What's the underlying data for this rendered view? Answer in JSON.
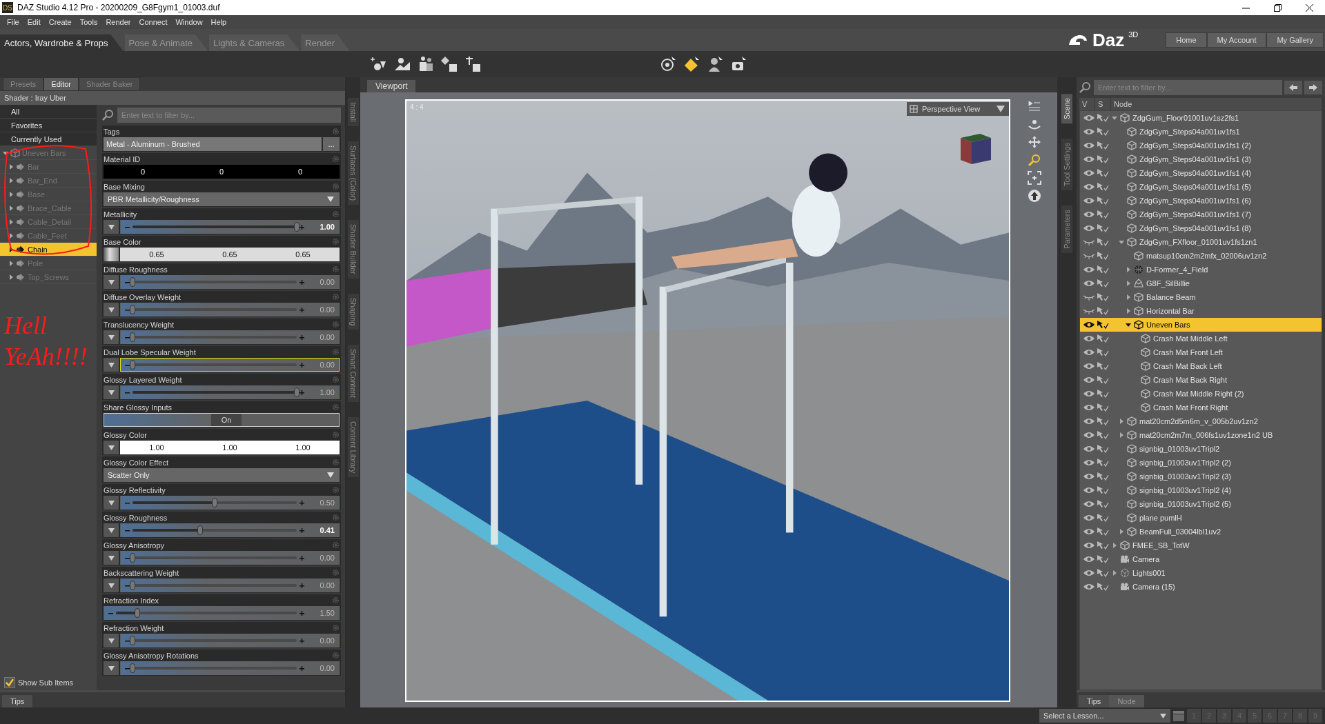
{
  "window": {
    "badge": "DS",
    "title": "DAZ Studio 4.12 Pro - 20200209_G8Fgym1_01003.duf"
  },
  "menu": [
    "File",
    "Edit",
    "Create",
    "Tools",
    "Render",
    "Connect",
    "Window",
    "Help"
  ],
  "rooms": [
    {
      "label": "Actors, Wardrobe & Props",
      "selected": true
    },
    {
      "label": "Pose & Animate",
      "selected": false
    },
    {
      "label": "Lights & Cameras",
      "selected": false
    },
    {
      "label": "Render",
      "selected": false
    }
  ],
  "brand": {
    "name": "Daz",
    "sup": "3D"
  },
  "links": [
    "Home",
    "My Account",
    "My Gallery"
  ],
  "left_panel": {
    "tabs": [
      {
        "label": "Presets",
        "selected": false
      },
      {
        "label": "Editor",
        "selected": true
      },
      {
        "label": "Shader Baker",
        "selected": false
      }
    ],
    "shader": "Shader : Iray Uber",
    "filters": [
      "All",
      "Favorites",
      "Currently Used"
    ],
    "tree": {
      "label": "Uneven Bars",
      "expanded": true,
      "children": [
        {
          "label": "Bar",
          "expanded": false,
          "selected": false
        },
        {
          "label": "Bar_End",
          "expanded": false,
          "selected": false
        },
        {
          "label": "Base",
          "expanded": false,
          "selected": false
        },
        {
          "label": "Brace_Cable",
          "expanded": false,
          "selected": false
        },
        {
          "label": "Cable_Detail",
          "expanded": false,
          "selected": false
        },
        {
          "label": "Cable_Feet",
          "expanded": false,
          "selected": false
        },
        {
          "label": "Chain",
          "expanded": false,
          "selected": true
        },
        {
          "label": "Pole",
          "expanded": false,
          "selected": false
        },
        {
          "label": "Top_Screws",
          "expanded": false,
          "selected": false
        }
      ]
    },
    "show_sub_items": {
      "label": "Show Sub Items",
      "checked": true
    },
    "search": {
      "placeholder": "Enter text to filter by..."
    },
    "properties": [
      {
        "kind": "tags",
        "label": "Tags",
        "value": "Metal - Aluminum - Brushed",
        "button": "..."
      },
      {
        "kind": "ids",
        "label": "Material ID",
        "values": [
          "0",
          "0",
          "0"
        ]
      },
      {
        "kind": "select",
        "label": "Base Mixing",
        "value": "PBR Metallicity/Roughness"
      },
      {
        "kind": "slider",
        "label": "Metallicity",
        "menu": true,
        "level": 1,
        "value": "1.00",
        "modified": true,
        "highlighted": false
      },
      {
        "kind": "color",
        "label": "Base Color",
        "mapped": true,
        "values": [
          "0.65",
          "0.65",
          "0.65"
        ]
      },
      {
        "kind": "slider",
        "label": "Diffuse Roughness",
        "menu": true,
        "level": 0,
        "value": "0.00",
        "modified": false,
        "highlighted": false
      },
      {
        "kind": "slider",
        "label": "Diffuse Overlay Weight",
        "menu": true,
        "level": 0,
        "value": "0.00",
        "modified": false,
        "highlighted": false
      },
      {
        "kind": "slider",
        "label": "Translucency Weight",
        "menu": true,
        "level": 0,
        "value": "0.00",
        "modified": false,
        "highlighted": false
      },
      {
        "kind": "slider",
        "label": "Dual Lobe Specular Weight",
        "menu": true,
        "level": 0,
        "value": "0.00",
        "modified": false,
        "highlighted": true
      },
      {
        "kind": "slider",
        "label": "Glossy Layered Weight",
        "menu": true,
        "level": 1,
        "value": "1.00",
        "modified": false,
        "highlighted": false
      },
      {
        "kind": "toggle",
        "label": "Share Glossy Inputs",
        "on": true,
        "value": "On"
      },
      {
        "kind": "color",
        "label": "Glossy Color",
        "mapped": false,
        "values": [
          "1.00",
          "1.00",
          "1.00"
        ]
      },
      {
        "kind": "select",
        "label": "Glossy Color Effect",
        "value": "Scatter Only"
      },
      {
        "kind": "slider",
        "label": "Glossy Reflectivity",
        "menu": true,
        "level": 0.5,
        "value": "0.50",
        "modified": false,
        "highlighted": false
      },
      {
        "kind": "slider",
        "label": "Glossy Roughness",
        "menu": true,
        "level": 0.41,
        "value": "0.41",
        "modified": true,
        "highlighted": false
      },
      {
        "kind": "slider",
        "label": "Glossy Anisotropy",
        "menu": true,
        "level": 0,
        "value": "0.00",
        "modified": false,
        "highlighted": false
      },
      {
        "kind": "slider",
        "label": "Backscattering Weight",
        "menu": true,
        "level": 0,
        "value": "0.00",
        "modified": false,
        "highlighted": false
      },
      {
        "kind": "slider",
        "label": "Refraction Index",
        "menu": false,
        "level": 0.12,
        "value": "1.50",
        "modified": false,
        "highlighted": false
      },
      {
        "kind": "slider",
        "label": "Refraction Weight",
        "menu": true,
        "level": 0,
        "value": "0.00",
        "modified": false,
        "highlighted": false
      },
      {
        "kind": "slider",
        "label": "Glossy Anisotropy Rotations",
        "menu": true,
        "level": 0,
        "value": "0.00",
        "modified": false,
        "highlighted": false
      }
    ],
    "tips_tab": "Tips"
  },
  "annotation": {
    "text": "Hell YeAh!!!!"
  },
  "side_tabs": [
    "Install",
    "Surfaces (Color)",
    "Shader Builder",
    "Shaping",
    "Smart Content",
    "Content Library"
  ],
  "viewport": {
    "tab": "Viewport",
    "aspect": "4 : 4",
    "view": "Perspective View"
  },
  "scene": {
    "side_tabs": [
      {
        "label": "Scene",
        "selected": true
      },
      {
        "label": "Tool Settings",
        "selected": false
      },
      {
        "label": "Parameters",
        "selected": false
      }
    ],
    "search": {
      "placeholder": "Enter text to filter by..."
    },
    "columns": [
      "V",
      "S",
      "Node"
    ],
    "nodes": [
      {
        "label": "ZdgGum_Floor01001uv1sz2fs1",
        "kind": "prop",
        "visible": true,
        "selected": false,
        "expanded": true,
        "children": [
          {
            "label": "ZdgGym_Steps04a001uv1fs1",
            "kind": "prop",
            "visible": true,
            "selected": false
          },
          {
            "label": "ZdgGym_Steps04a001uv1fs1 (2)",
            "kind": "prop",
            "visible": true,
            "selected": false
          },
          {
            "label": "ZdgGym_Steps04a001uv1fs1 (3)",
            "kind": "prop",
            "visible": true,
            "selected": false
          },
          {
            "label": "ZdgGym_Steps04a001uv1fs1 (4)",
            "kind": "prop",
            "visible": true,
            "selected": false
          },
          {
            "label": "ZdgGym_Steps04a001uv1fs1 (5)",
            "kind": "prop",
            "visible": true,
            "selected": false
          },
          {
            "label": "ZdgGym_Steps04a001uv1fs1 (6)",
            "kind": "prop",
            "visible": true,
            "selected": false
          },
          {
            "label": "ZdgGym_Steps04a001uv1fs1 (7)",
            "kind": "prop",
            "visible": true,
            "selected": false
          },
          {
            "label": "ZdgGym_Steps04a001uv1fs1 (8)",
            "kind": "prop",
            "visible": true,
            "selected": false
          },
          {
            "label": "ZdgGym_FXfloor_01001uv1fs1zn1",
            "kind": "prop",
            "visible": false,
            "selected": false,
            "expanded": true,
            "children": [
              {
                "label": "matsup10cm2m2mfx_02006uv1zn2",
                "kind": "prop",
                "visible": false,
                "selected": false
              },
              {
                "label": "D-Former_4_Field",
                "kind": "deformer",
                "visible": true,
                "selected": false,
                "expanded": false
              },
              {
                "label": "G8F_SilBillie",
                "kind": "figure",
                "visible": true,
                "selected": false,
                "expanded": false
              },
              {
                "label": "Balance Beam",
                "kind": "prop",
                "visible": false,
                "selected": false,
                "expanded": false
              },
              {
                "label": "Horizontal Bar",
                "kind": "prop",
                "visible": false,
                "selected": false,
                "expanded": false
              },
              {
                "label": "Uneven Bars",
                "kind": "prop",
                "visible": true,
                "selected": true,
                "expanded": true,
                "children": [
                  {
                    "label": "Crash Mat Middle Left",
                    "kind": "prop",
                    "visible": true,
                    "selected": false
                  },
                  {
                    "label": "Crash Mat Front Left",
                    "kind": "prop",
                    "visible": true,
                    "selected": false
                  },
                  {
                    "label": "Crash Mat Back Left",
                    "kind": "prop",
                    "visible": true,
                    "selected": false
                  },
                  {
                    "label": "Crash Mat Back Right",
                    "kind": "prop",
                    "visible": true,
                    "selected": false
                  },
                  {
                    "label": "Crash Mat Middle Right (2)",
                    "kind": "prop",
                    "visible": true,
                    "selected": false
                  },
                  {
                    "label": "Crash Mat Front Right",
                    "kind": "prop",
                    "visible": true,
                    "selected": false
                  }
                ]
              }
            ]
          },
          {
            "label": "mat20cm2d5m6m_v_005b2uv1zn2",
            "kind": "prop",
            "visible": true,
            "selected": false,
            "expanded": false
          },
          {
            "label": "mat20cm2m7m_006fs1uv1zone1n2 UB",
            "kind": "prop",
            "visible": true,
            "selected": false,
            "expanded": false
          },
          {
            "label": "signbig_01003uv1Tripl2",
            "kind": "prop",
            "visible": true,
            "selected": false
          },
          {
            "label": "signbig_01003uv1Tripl2 (2)",
            "kind": "prop",
            "visible": true,
            "selected": false
          },
          {
            "label": "signbig_01003uv1Tripl2 (3)",
            "kind": "prop",
            "visible": true,
            "selected": false
          },
          {
            "label": "signbig_01003uv1Tripl2 (4)",
            "kind": "prop",
            "visible": true,
            "selected": false
          },
          {
            "label": "signbig_01003uv1Tripl2 (5)",
            "kind": "prop",
            "visible": true,
            "selected": false
          },
          {
            "label": "plane pumlH",
            "kind": "prop",
            "visible": true,
            "selected": false
          },
          {
            "label": "BeamFull_03004lbl1uv2",
            "kind": "prop",
            "visible": true,
            "selected": false,
            "expanded": false
          }
        ]
      },
      {
        "label": "FMEE_SB_TotW",
        "kind": "prop",
        "visible": true,
        "selected": false,
        "expanded": false
      },
      {
        "label": "Camera",
        "kind": "camera",
        "visible": true,
        "selected": false
      },
      {
        "label": "Lights001",
        "kind": "light",
        "visible": true,
        "selected": false,
        "expanded": false
      },
      {
        "label": "Camera (15)",
        "kind": "camera",
        "visible": true,
        "selected": false
      }
    ],
    "tabs": [
      {
        "label": "Tips",
        "selected": true
      },
      {
        "label": "Node",
        "selected": false
      }
    ]
  },
  "status_bar": {
    "lesson": "Select a Lesson...",
    "pages": [
      "1",
      "2",
      "3",
      "4",
      "5",
      "6",
      "7",
      "8",
      "9"
    ]
  }
}
